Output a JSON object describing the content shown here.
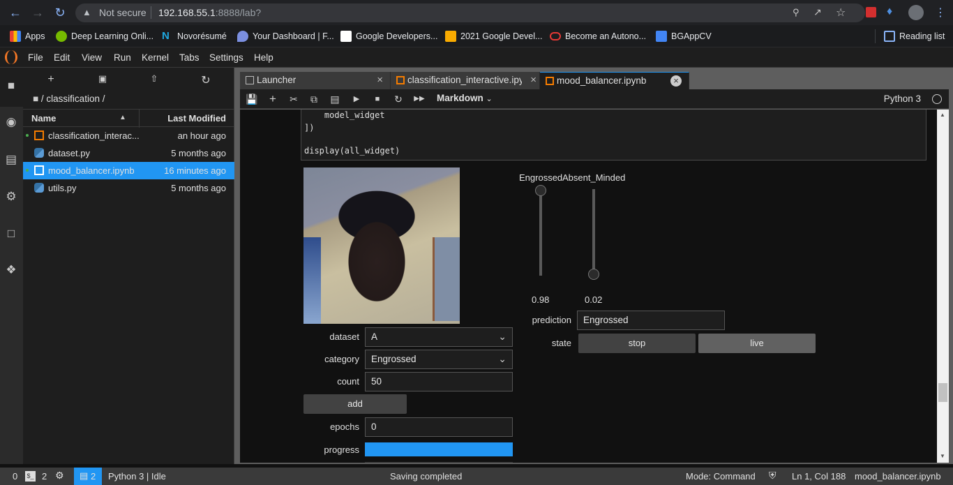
{
  "browser": {
    "security_label": "Not secure",
    "url_host": "192.168.55.1",
    "url_rest": ":8888/lab?",
    "bookmarks": [
      {
        "label": "Apps",
        "icon": "apps-grid-icon"
      },
      {
        "label": "Deep Learning Onli...",
        "icon": "nvidia-icon"
      },
      {
        "label": "Novorésumé",
        "icon": "novoresume-icon"
      },
      {
        "label": "Your Dashboard | F...",
        "icon": "heart-shield-icon"
      },
      {
        "label": "Google Developers...",
        "icon": "google-developers-icon"
      },
      {
        "label": "2021 Google Devel...",
        "icon": "slides-icon"
      },
      {
        "label": "Become an Autono...",
        "icon": "oracle-icon"
      },
      {
        "label": "BGAppCV",
        "icon": "docs-icon"
      }
    ],
    "reading_list": "Reading list"
  },
  "menu": [
    "File",
    "Edit",
    "View",
    "Run",
    "Kernel",
    "Tabs",
    "Settings",
    "Help"
  ],
  "filebrowser": {
    "breadcrumb": "/ classification /",
    "col_name": "Name",
    "col_modified": "Last Modified",
    "files": [
      {
        "name": "classification_interac...",
        "modified": "an hour ago",
        "type": "notebook",
        "running": true,
        "selected": false
      },
      {
        "name": "dataset.py",
        "modified": "5 months ago",
        "type": "python",
        "running": false,
        "selected": false
      },
      {
        "name": "mood_balancer.ipynb",
        "modified": "16 minutes ago",
        "type": "notebook",
        "running": true,
        "selected": true
      },
      {
        "name": "utils.py",
        "modified": "5 months ago",
        "type": "python",
        "running": false,
        "selected": false
      }
    ]
  },
  "tabs": [
    {
      "label": "Launcher",
      "active": false
    },
    {
      "label": "classification_interactive.ipyn",
      "active": false
    },
    {
      "label": "mood_balancer.ipynb",
      "active": true
    }
  ],
  "notebook_toolbar": {
    "cell_type": "Markdown",
    "kernel": "Python 3"
  },
  "code_lines": [
    "    model_widget",
    "])",
    "",
    "display(all_widget)"
  ],
  "widgets": {
    "dataset_label": "dataset",
    "dataset_value": "A",
    "category_label": "category",
    "category_value": "Engrossed",
    "count_label": "count",
    "count_value": "50",
    "add_label": "add",
    "epochs_label": "epochs",
    "epochs_value": "0",
    "progress_label": "progress",
    "progress_value": 1.0,
    "sliders": [
      {
        "label": "Engrossed",
        "value": 0.98,
        "value_text": "0.98"
      },
      {
        "label": "Absent_Minded",
        "value": 0.02,
        "value_text": "0.02"
      }
    ],
    "prediction_label": "prediction",
    "prediction_value": "Engrossed",
    "state_label": "state",
    "state_options": [
      "stop",
      "live"
    ],
    "state_selected": "live"
  },
  "statusbar": {
    "terminals": "0",
    "kernels": "2",
    "open_tabs": "2",
    "kernel_status": "Python 3 | Idle",
    "message": "Saving completed",
    "mode": "Mode: Command",
    "cursor": "Ln 1, Col 188",
    "filename": "mood_balancer.ipynb"
  },
  "colors": {
    "accent": "#2196f3",
    "notebook_icon": "#f57c00",
    "running_dot": "#4caf50"
  }
}
